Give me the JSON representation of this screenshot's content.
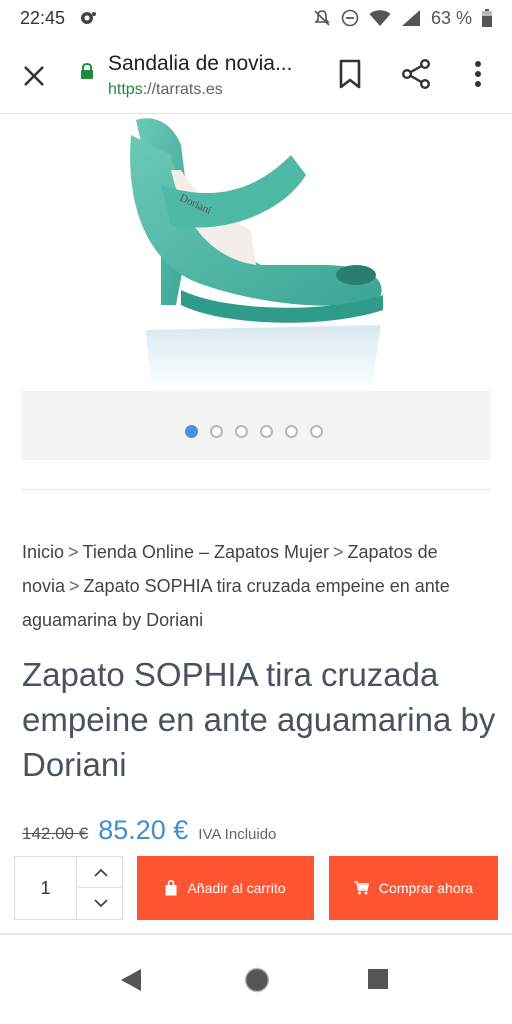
{
  "status_bar": {
    "time": "22:45",
    "battery_percent": "63 %",
    "icons": [
      "chrome-notification-icon",
      "mute-icon",
      "do-not-disturb-icon",
      "wifi-icon",
      "signal-icon",
      "battery-icon"
    ]
  },
  "toolbar": {
    "title": "Sandalia de novia...",
    "url_scheme": "https",
    "url_rest": "://tarrats.es",
    "icons": [
      "close-icon",
      "lock-icon",
      "bookmark-icon",
      "share-icon",
      "more-vert-icon"
    ]
  },
  "gallery": {
    "image": "aquamarine-suede-peep-toe-sandal",
    "dot_count": 6,
    "active_dot": 0
  },
  "breadcrumb": {
    "items": [
      "Inicio",
      "Tienda Online – Zapatos Mujer",
      "Zapatos de novia",
      "Zapato SOPHIA tira cruzada empeine en ante aguamarina by Doriani"
    ],
    "separator": ">"
  },
  "product": {
    "title": "Zapato SOPHIA tira cruzada empeine en ante aguamarina by Doriani",
    "old_price": "142.00 €",
    "price": "85.20 €",
    "tax_note": "IVA Incluido"
  },
  "purchase": {
    "quantity": "1",
    "add_to_cart_label": "Añadir al carrito",
    "buy_now_label": "Comprar ahora",
    "button_color": "#ff5533"
  },
  "colors": {
    "accent_price": "#3f8fd2",
    "active_dot": "#4a90e2",
    "secure_scheme": "#1e8e3e"
  },
  "navbar": {
    "icons": [
      "back-icon",
      "home-icon",
      "recents-icon"
    ]
  }
}
